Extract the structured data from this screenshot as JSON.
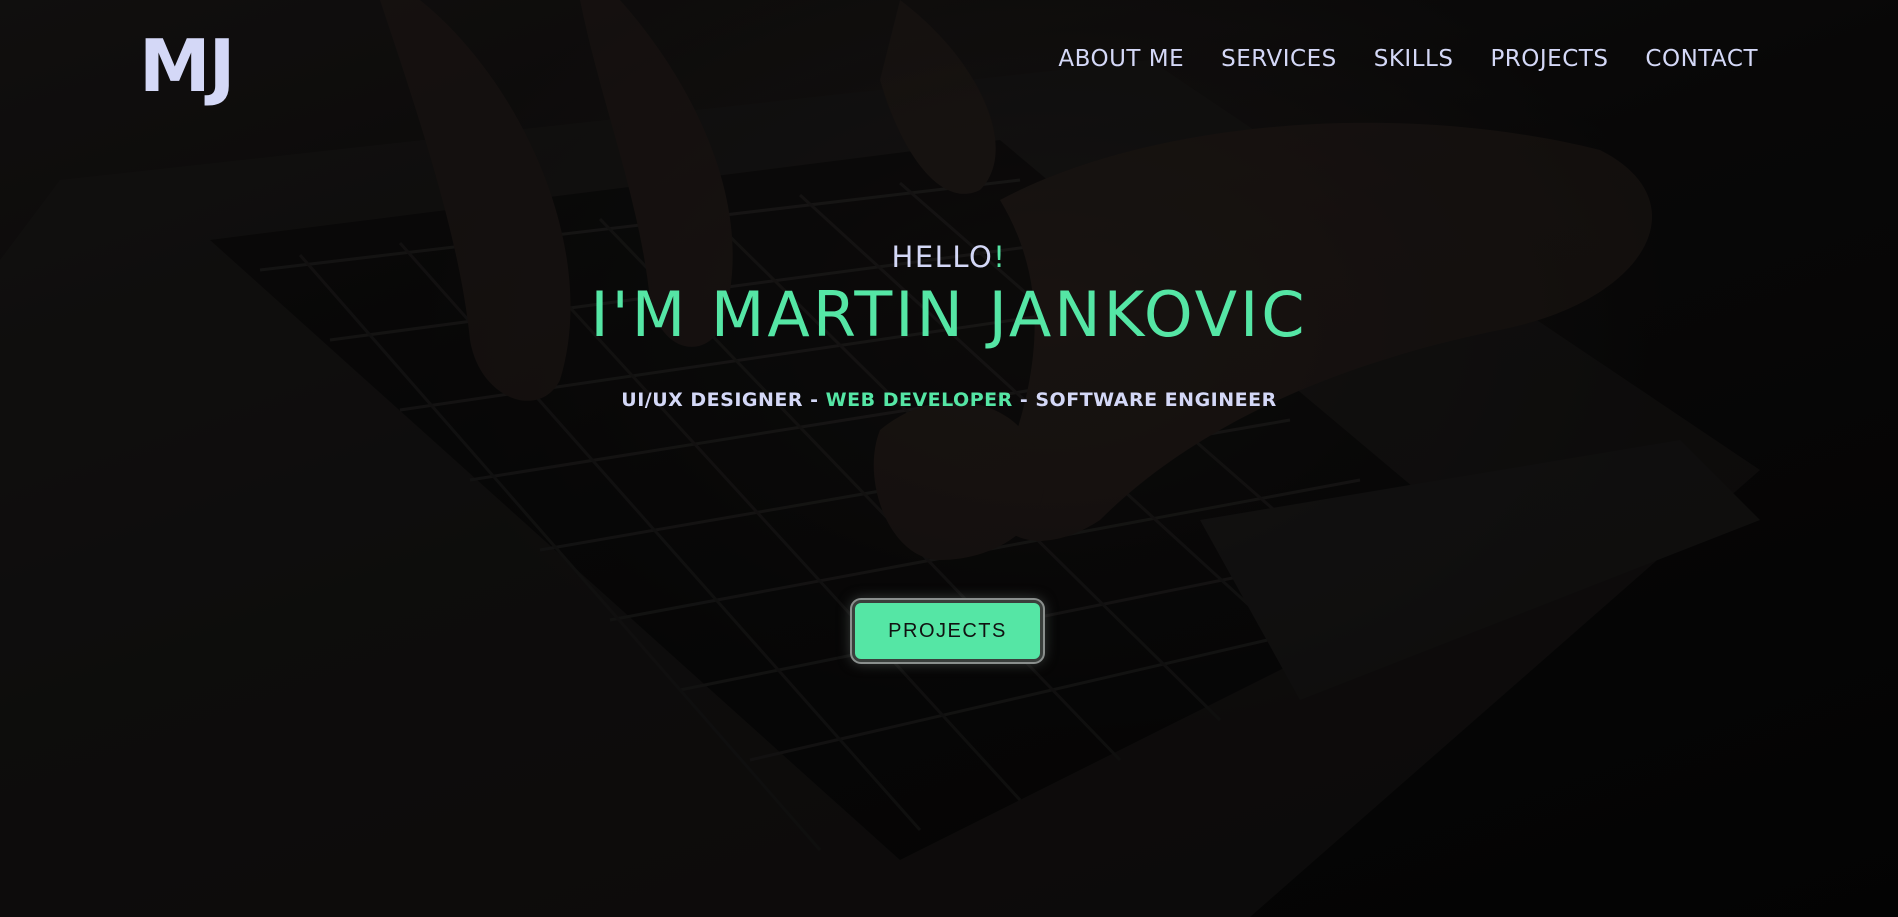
{
  "logo": {
    "text": "MJ"
  },
  "nav": {
    "items": [
      {
        "label": "ABOUT ME"
      },
      {
        "label": "SERVICES"
      },
      {
        "label": "SKILLS"
      },
      {
        "label": "PROJECTS"
      },
      {
        "label": "CONTACT"
      }
    ]
  },
  "hero": {
    "greeting": "HELLO",
    "greeting_mark": "!",
    "name": "I'M MARTIN JANKOVIC",
    "roles": {
      "role1": "UI/UX DESIGNER",
      "sep1": " - ",
      "role2": "WEB DEVELOPER",
      "sep2": " - ",
      "role3": "SOFTWARE ENGINEER"
    },
    "cta_label": "PROJECTS"
  },
  "colors": {
    "accent": "#55e6a5",
    "text": "#d4d8f7",
    "background": "#050505"
  }
}
